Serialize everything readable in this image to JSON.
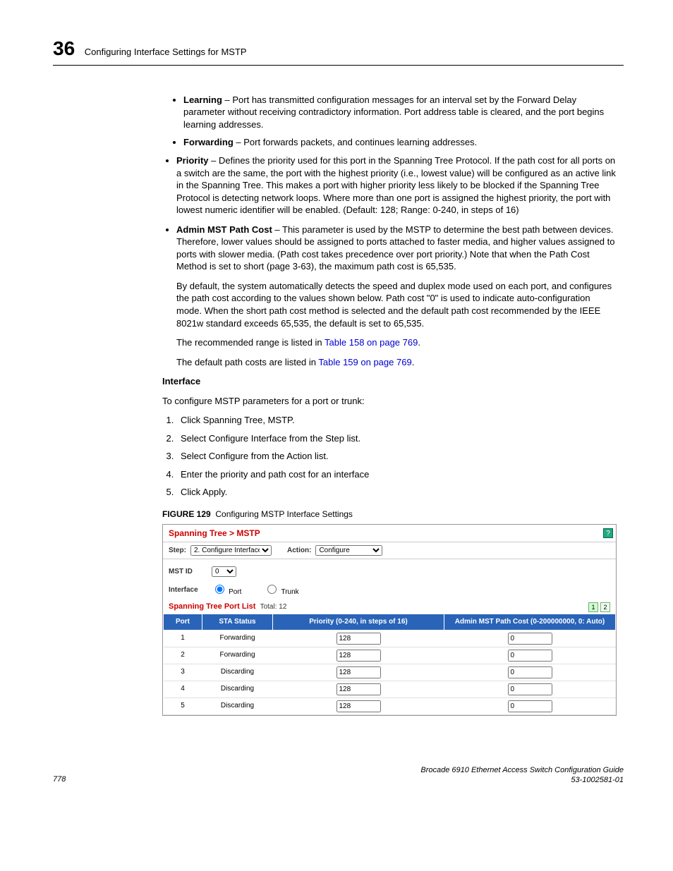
{
  "header": {
    "chapter": "36",
    "title": "Configuring Interface Settings for MSTP"
  },
  "bullets": {
    "learning_label": "Learning",
    "learning_text": " – Port has transmitted configuration messages for an interval set by the Forward Delay parameter without receiving contradictory information. Port address table is cleared, and the port begins learning addresses.",
    "forwarding_label": "Forwarding",
    "forwarding_text": " – Port forwards packets, and continues learning addresses.",
    "priority_label": "Priority",
    "priority_text": " – Defines the priority used for this port in the Spanning Tree Protocol. If the path cost for all ports on a switch are the same, the port with the highest priority (i.e., lowest value) will be configured as an active link in the Spanning Tree. This makes a port with higher priority less likely to be blocked if the Spanning Tree Protocol is detecting network loops. Where more than one port is assigned the highest priority, the port with lowest numeric identifier will be enabled. (Default: 128; Range: 0-240, in steps of 16)",
    "admin_label": "Admin MST Path Cost",
    "admin_text": " – This parameter is used by the MSTP to determine the best path between devices. Therefore, lower values should be assigned to ports attached to faster media, and higher values assigned to ports with slower media. (Path cost takes precedence over port priority.) Note that when the Path Cost Method is set to short (page 3-63), the maximum path cost is 65,535.",
    "admin_para2": "By default, the system automatically detects the speed and duplex mode used on each port, and configures the path cost according to the values shown below. Path cost \"0\" is used to indicate auto-configuration mode. When the short path cost method is selected and the default path cost recommended by the IEEE 8021w standard exceeds 65,535, the default is set to 65,535.",
    "rec_range_pre": "The recommended range is listed in ",
    "rec_range_link": "Table 158 on page 769",
    "def_cost_pre": "The default path costs are listed in ",
    "def_cost_link": "Table 159 on page 769",
    "period": "."
  },
  "interface": {
    "heading": "Interface",
    "intro": "To configure MSTP parameters for a port or trunk:",
    "steps": [
      "Click Spanning Tree, MSTP.",
      "Select Configure Interface from the Step list.",
      "Select Configure from the Action list.",
      "Enter the priority and path cost for an interface",
      "Click Apply."
    ]
  },
  "figure": {
    "caption_prefix": "FIGURE 129",
    "caption_text": "Configuring MSTP Interface Settings",
    "title": "Spanning Tree > MSTP",
    "step_label": "Step:",
    "step_value": "2. Configure Interface",
    "action_label": "Action:",
    "action_value": "Configure",
    "mstid_label": "MST ID",
    "mstid_value": "0",
    "interface_label": "Interface",
    "radio_port": "Port",
    "radio_trunk": "Trunk",
    "portlist_title": "Spanning Tree Port List",
    "total_label": "Total: 12",
    "icon1": "1",
    "icon2": "2",
    "headers": {
      "port": "Port",
      "sta": "STA Status",
      "priority": "Priority (0-240, in steps of 16)",
      "cost": "Admin MST Path Cost (0-200000000, 0: Auto)"
    },
    "rows": [
      {
        "port": "1",
        "sta": "Forwarding",
        "priority": "128",
        "cost": "0"
      },
      {
        "port": "2",
        "sta": "Forwarding",
        "priority": "128",
        "cost": "0"
      },
      {
        "port": "3",
        "sta": "Discarding",
        "priority": "128",
        "cost": "0"
      },
      {
        "port": "4",
        "sta": "Discarding",
        "priority": "128",
        "cost": "0"
      },
      {
        "port": "5",
        "sta": "Discarding",
        "priority": "128",
        "cost": "0"
      }
    ]
  },
  "footer": {
    "page": "778",
    "book": "Brocade 6910 Ethernet Access Switch Configuration Guide",
    "docid": "53-1002581-01"
  }
}
